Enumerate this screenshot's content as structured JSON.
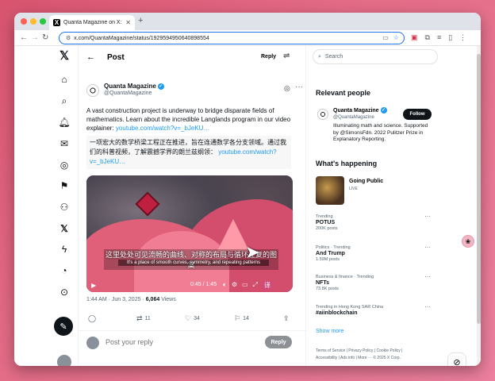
{
  "browser": {
    "tab_title": "Quanta Magazine on X: \"A v",
    "url": "x.com/QuantaMagazine/status/1929594950640898554",
    "colors": {
      "close": "#ff5f57",
      "min": "#febc2e",
      "max": "#28c840"
    }
  },
  "header": {
    "title": "Post",
    "reply_label": "Reply"
  },
  "author": {
    "name": "Quanta Magazine",
    "handle": "@QuantaMagazine"
  },
  "tweet": {
    "text_main": "A vast construction project is underway to bridge disparate fields of mathematics. Learn about the incredible Langlands program in our video explainer: ",
    "text_link": "youtube.com/watch?v=_bJeKU…",
    "translation_main": "一项宏大的数学桥梁工程正在推进，旨在连通数学各分支领域。通过我们的科普视频，了解震撼学界的朗兰兹纲领：",
    "translation_link": "youtube.com/watch?v=_bJeKU…",
    "meta_time": "1:44 AM · Jun 3, 2025 · ",
    "views_count": "6,064",
    "views_label": " Views"
  },
  "video": {
    "subtitle_zh": "这里处处可见流畅的曲线、对称的布局与循环往复的图案",
    "subtitle_en": "It's a place of smooth curves, symmetry, and repeating patterns",
    "time": "0:45 / 1:45"
  },
  "actions": {
    "retweets": "11",
    "likes": "34",
    "bookmarks": "14"
  },
  "reply_box": {
    "placeholder": "Post your reply",
    "button": "Reply"
  },
  "right": {
    "search_placeholder": "Search",
    "relevant_title": "Relevant people",
    "rp_name": "Quanta Magazine",
    "rp_handle": "@QuantaMagazine",
    "follow": "Follow",
    "rp_bio": "Illuminating math and science. Supported by @SimonsFdn. 2022 Pulitzer Prize in Explanatory Reporting.",
    "happening_title": "What's happening",
    "live_title": "Going Public",
    "live_label": "LIVE",
    "trends": [
      {
        "cat": "Trending",
        "name": "POTUS",
        "count": "200K posts"
      },
      {
        "cat": "Politics · Trending",
        "name": "And Trump",
        "count": "1.59M posts"
      },
      {
        "cat": "Business & finance · Trending",
        "name": "NFTs",
        "count": "73.8K posts"
      },
      {
        "cat": "Trending in Hong Kong SAR China",
        "name": "#aiinblockchain",
        "count": ""
      }
    ],
    "show_more": "Show more",
    "footer_1": "Terms of Service  |  Privacy Policy  |  Cookie Policy  |",
    "footer_2": "Accessibility  |  Ads info  |  More ···  © 2025 X Corp."
  }
}
